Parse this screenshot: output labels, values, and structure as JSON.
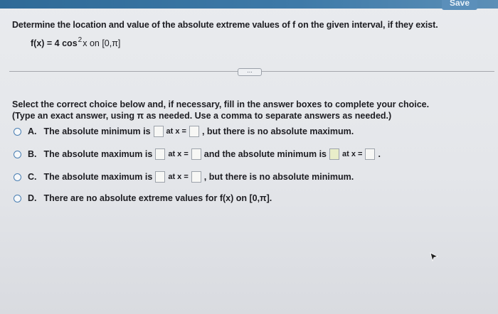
{
  "header": {
    "save_label": "Save"
  },
  "question": {
    "prompt": "Determine the location and value of the absolute extreme values of f on the given interval, if they exist.",
    "function_lhs": "f(x) = 4 cos",
    "function_exp": "2",
    "function_rhs": "x on [0,π]"
  },
  "more_label": "...",
  "instructions": {
    "line1": "Select the correct choice below and, if necessary, fill in the answer boxes to complete your choice.",
    "line2": "(Type an exact answer, using π as needed. Use a comma to separate answers as needed.)"
  },
  "choices": {
    "a": {
      "letter": "A.",
      "t1": "The absolute minimum is",
      "t2": "at x =",
      "t3": ", but there is no absolute maximum."
    },
    "b": {
      "letter": "B.",
      "t1": "The absolute maximum is",
      "t2": "at x =",
      "t3": "and the absolute minimum is",
      "t4": "at x =",
      "t5": "."
    },
    "c": {
      "letter": "C.",
      "t1": "The absolute maximum is",
      "t2": "at x =",
      "t3": ", but there is no absolute minimum."
    },
    "d": {
      "letter": "D.",
      "t1": "There are no absolute extreme values for f(x) on [0,π]."
    }
  }
}
